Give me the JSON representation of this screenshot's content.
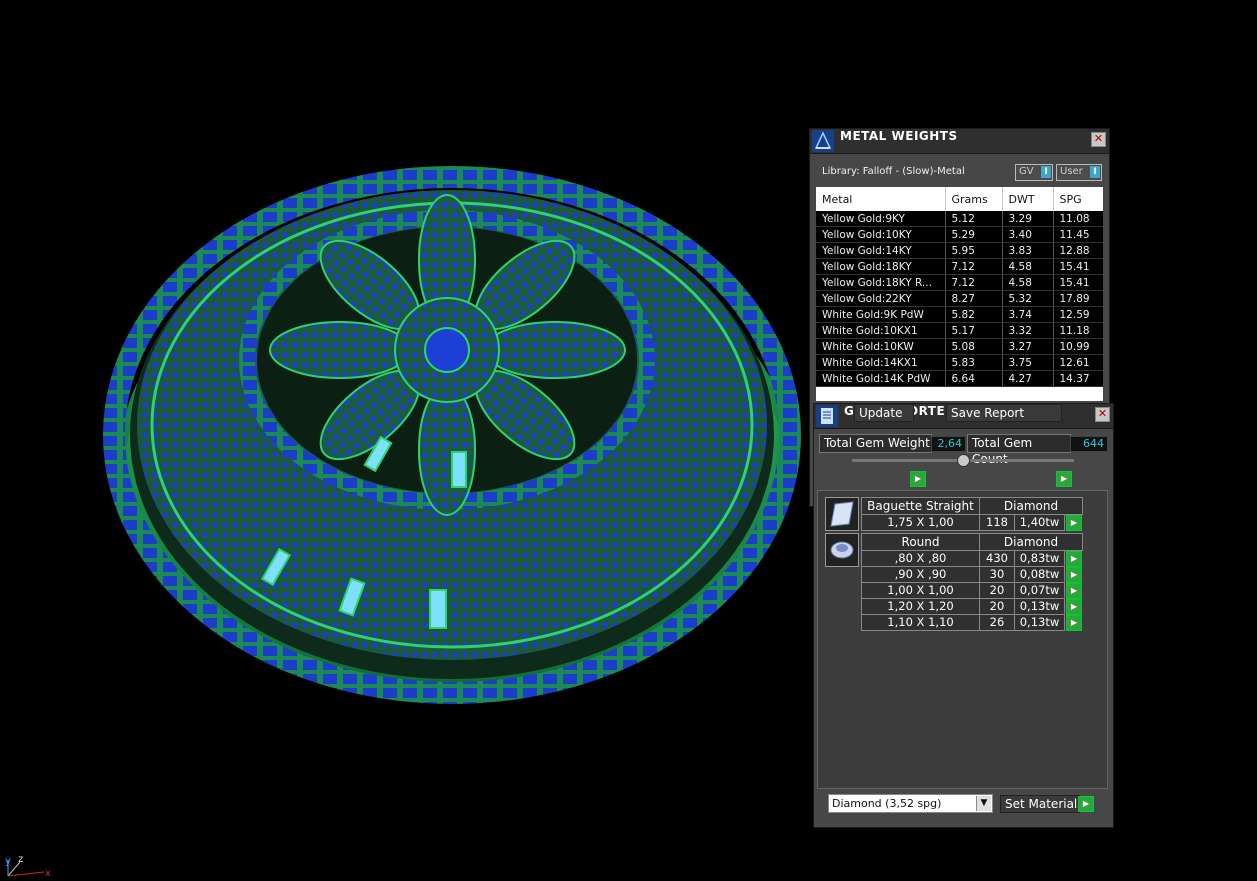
{
  "viewport": {
    "axis": {
      "y": "y",
      "z": "z",
      "x": "x"
    }
  },
  "metal_weights": {
    "title": "METAL WEIGHTS",
    "library": "Library: Falloff - (Slow)-Metal",
    "toggle_gv": "GV",
    "toggle_user": "User",
    "toggle_knob": "I",
    "columns": [
      "Metal",
      "Grams",
      "DWT",
      "SPG"
    ],
    "rows": [
      [
        "Yellow Gold:9KY",
        "5.12",
        "3.29",
        "11.08"
      ],
      [
        "Yellow Gold:10KY",
        "5.29",
        "3.40",
        "11.45"
      ],
      [
        "Yellow Gold:14KY",
        "5.95",
        "3.83",
        "12.88"
      ],
      [
        "Yellow Gold:18KY",
        "7.12",
        "4.58",
        "15.41"
      ],
      [
        "Yellow Gold:18KY R...",
        "7.12",
        "4.58",
        "15.41"
      ],
      [
        "Yellow Gold:22KY",
        "8.27",
        "5.32",
        "17.89"
      ],
      [
        "White Gold:9K PdW",
        "5.82",
        "3.74",
        "12.59"
      ],
      [
        "White Gold:10KX1",
        "5.17",
        "3.32",
        "11.18"
      ],
      [
        "White Gold:10KW",
        "5.08",
        "3.27",
        "10.99"
      ],
      [
        "White Gold:14KX1",
        "5.83",
        "3.75",
        "12.61"
      ],
      [
        "White Gold:14K PdW",
        "6.64",
        "4.27",
        "14.37"
      ]
    ]
  },
  "gem_reporter": {
    "title": "GEM REPORTER",
    "total_weight_label": "Total Gem Weight",
    "total_weight_value": "2,64",
    "total_count_label": "Total Gem Count",
    "total_count_value": "644",
    "update_label": "Update",
    "save_label": "Save Report",
    "groups": [
      {
        "shape": "Baguette Straight",
        "material": "Diamond",
        "rows": [
          {
            "size": "1,75 X 1,00",
            "count": "118",
            "weight": "1,40tw"
          }
        ]
      },
      {
        "shape": "Round",
        "material": "Diamond",
        "rows": [
          {
            "size": ",80 X ,80",
            "count": "430",
            "weight": "0,83tw"
          },
          {
            "size": ",90 X ,90",
            "count": "30",
            "weight": "0,08tw"
          },
          {
            "size": "1,00 X 1,00",
            "count": "20",
            "weight": "0,07tw"
          },
          {
            "size": "1,20 X 1,20",
            "count": "20",
            "weight": "0,13tw"
          },
          {
            "size": "1,10 X 1,10",
            "count": "26",
            "weight": "0,13tw"
          }
        ]
      }
    ],
    "material_select": "Diamond      (3,52 spg)",
    "set_material_label": "Set Material"
  },
  "colors": {
    "metal_green": "#2fd36a",
    "gem_blue": "#1d3fd6",
    "accent_cyan": "#2ec7d6",
    "go_green": "#2fa43c"
  }
}
